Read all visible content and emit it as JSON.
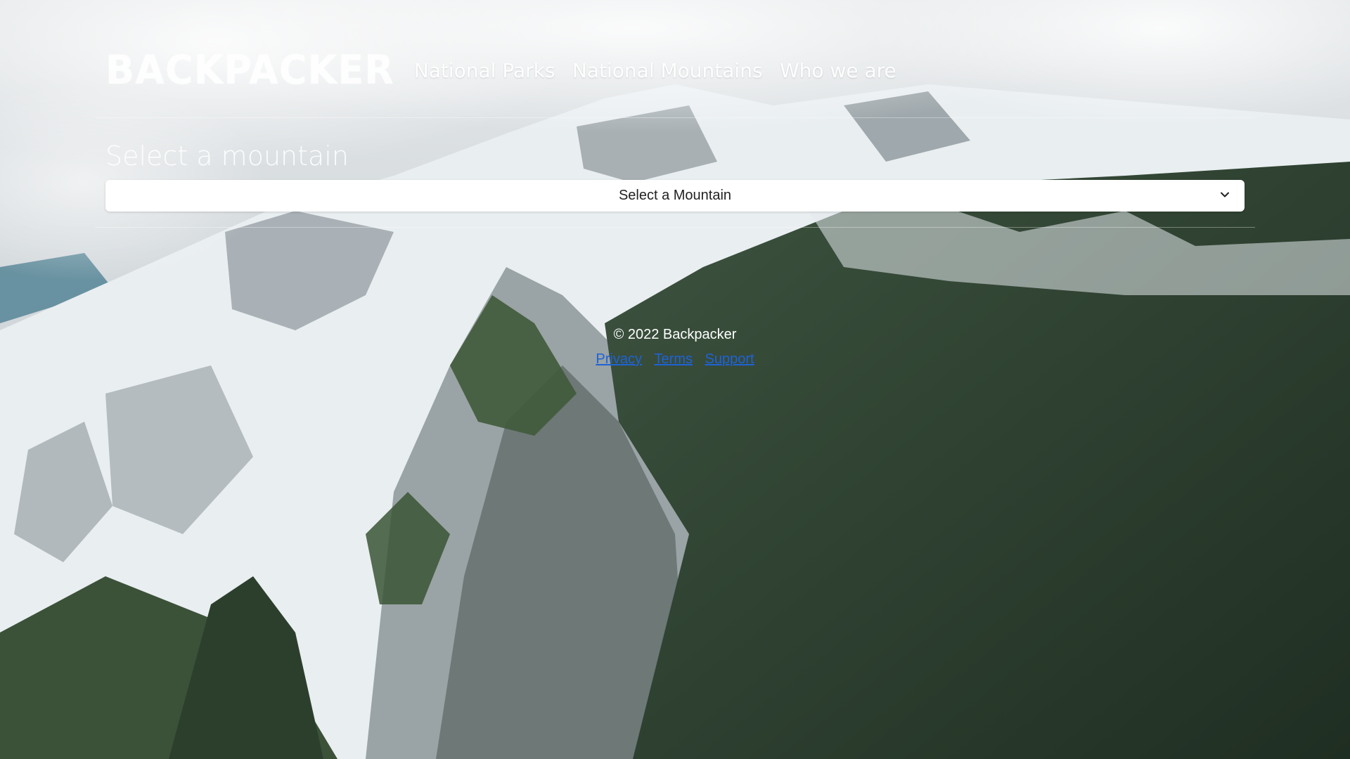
{
  "brand": {
    "logo_text": "Backpacker"
  },
  "nav": {
    "items": [
      {
        "label": "National Parks"
      },
      {
        "label": "National Mountains"
      },
      {
        "label": "Who we are"
      }
    ]
  },
  "main": {
    "heading": "Select a mountain",
    "select": {
      "selected": "Select a Mountain"
    }
  },
  "footer": {
    "copyright": "© 2022 Backpacker",
    "links": [
      "Privacy",
      "Terms",
      "Support"
    ]
  },
  "colors": {
    "link": "#1e63d6",
    "text_on_image": "#ffffff"
  }
}
